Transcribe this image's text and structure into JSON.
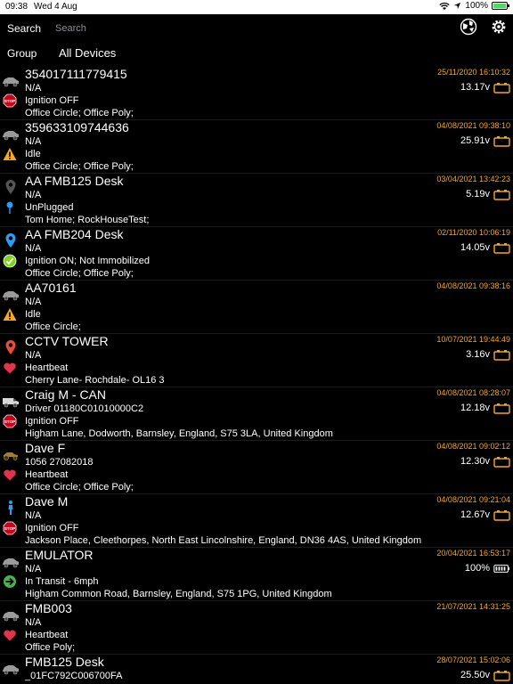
{
  "statusbar": {
    "time": "09:38",
    "date": "Wed 4 Aug",
    "battery": "100%"
  },
  "header": {
    "search_label": "Search",
    "search_placeholder": "Search",
    "group_label": "Group",
    "group_value": "All Devices"
  },
  "colors": {
    "timestamp": "#f5a623",
    "battery_icon": "#f5a623",
    "battery_full": "#ffffff",
    "stop": "#d0021b",
    "idle": "#f5a623",
    "heart": "#e0334c",
    "pin_blue": "#2a9df4",
    "pin_red": "#e74c3c",
    "check_green": "#7ed321",
    "transit_green": "#4caf50"
  },
  "devices": [
    {
      "name": "354017111779415",
      "line2": "N/A",
      "status": "Ignition OFF",
      "location": "Office Circle; Office Poly;",
      "timestamp": "25/11/2020 16:10:32",
      "voltage": "13.17v",
      "vehicle_icon": "car-icon",
      "status_icon": "stop-icon",
      "battery_icon": "battery-low-icon"
    },
    {
      "name": "359633109744636",
      "line2": "N/A",
      "status": "Idle",
      "location": "Office Circle; Office Poly;",
      "timestamp": "04/08/2021 09:38:10",
      "voltage": "25.91v",
      "vehicle_icon": "car-icon",
      "status_icon": "idle-warning-icon",
      "battery_icon": "battery-low-icon"
    },
    {
      "name": "AA FMB125 Desk",
      "line2": "N/A",
      "status": "UnPlugged",
      "location": "Tom Home; RockHouseTest;",
      "timestamp": "03/04/2021 13:42:23",
      "voltage": "5.19v",
      "vehicle_icon": "map-pin-grey-icon",
      "status_icon": "unplugged-pin-icon",
      "battery_icon": "battery-low-icon"
    },
    {
      "name": "AA FMB204 Desk",
      "line2": "N/A",
      "status": "Ignition ON; Not Immobilized",
      "location": "Office Circle; Office Poly;",
      "timestamp": "02/11/2020 10:06:19",
      "voltage": "14.05v",
      "vehicle_icon": "map-pin-blue-icon",
      "status_icon": "ignition-on-icon",
      "battery_icon": "battery-low-icon"
    },
    {
      "name": "AA70161",
      "line2": "N/A",
      "status": "Idle",
      "location": "Office Circle;",
      "timestamp": "04/08/2021 09:38:16",
      "voltage": "",
      "vehicle_icon": "car-icon",
      "status_icon": "idle-warning-icon",
      "battery_icon": ""
    },
    {
      "name": "CCTV TOWER",
      "line2": "N/A",
      "status": "Heartbeat",
      "location": "Cherry Lane- Rochdale- OL16 3",
      "timestamp": "10/07/2021 19:44:49",
      "voltage": "3.16v",
      "vehicle_icon": "map-pin-red-icon",
      "status_icon": "heart-icon",
      "battery_icon": "battery-low-icon"
    },
    {
      "name": "Craig M - CAN",
      "line2": "Driver 01180C01010000C2",
      "status": "Ignition OFF",
      "location": "Higham Lane, Dodworth, Barnsley, England, S75 3LA, United Kingdom",
      "timestamp": "04/08/2021 08:28:07",
      "voltage": "12.18v",
      "vehicle_icon": "van-icon",
      "status_icon": "stop-icon",
      "battery_icon": "battery-low-icon"
    },
    {
      "name": "Dave F",
      "line2": "1056 27082018",
      "status": "Heartbeat",
      "location": "Office Circle; Office Poly;",
      "timestamp": "04/08/2021 09:02:12",
      "voltage": "12.30v",
      "vehicle_icon": "tractor-icon",
      "status_icon": "heart-icon",
      "battery_icon": "battery-low-icon"
    },
    {
      "name": "Dave M",
      "line2": "N/A",
      "status": "Ignition OFF",
      "location": "Jackson Place, Cleethorpes, North East Lincolnshire, England, DN36 4AS, United Kingdom",
      "timestamp": "04/08/2021 09:21:04",
      "voltage": "12.67v",
      "vehicle_icon": "person-icon",
      "status_icon": "stop-icon",
      "battery_icon": "battery-low-icon"
    },
    {
      "name": "EMULATOR",
      "line2": "N/A",
      "status": "In Transit - 6mph",
      "location": "Higham Common Road, Barnsley, England, S75 1PG, United Kingdom",
      "timestamp": "20/04/2021 16:53:17",
      "voltage": "100%",
      "vehicle_icon": "car-icon",
      "status_icon": "transit-arrow-icon",
      "battery_icon": "battery-full-icon"
    },
    {
      "name": "FMB003",
      "line2": "N/A",
      "status": "Heartbeat",
      "location": "Office Poly;",
      "timestamp": "21/07/2021 14:31:25",
      "voltage": "",
      "vehicle_icon": "car-icon",
      "status_icon": "heart-icon",
      "battery_icon": ""
    },
    {
      "name": "FMB125 Desk",
      "line2": "_01FC792C006700FA",
      "status": "",
      "location": "",
      "timestamp": "28/07/2021 15:02:06",
      "voltage": "25.50v",
      "vehicle_icon": "car-icon",
      "status_icon": "",
      "battery_icon": "battery-low-icon"
    }
  ]
}
